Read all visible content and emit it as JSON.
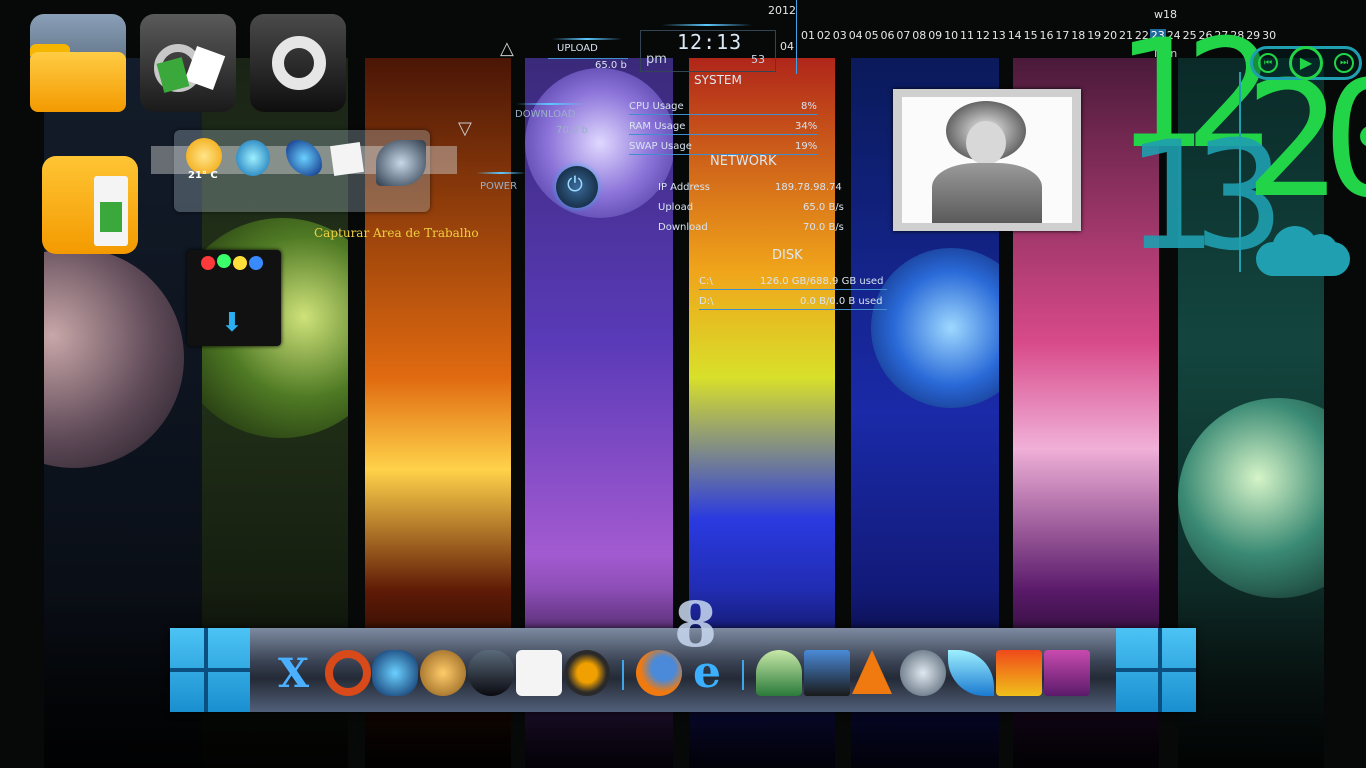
{
  "desktop": {
    "shortcut_label": "Capturar Area de Trabalho"
  },
  "weather": {
    "temperature": "21° C"
  },
  "network_meter": {
    "upload_label": "UPLOAD",
    "upload_value": "65.0 b",
    "download_label": "DOWNLOAD",
    "download_value": "70.0 b",
    "power_label": "POWER"
  },
  "digital_clock": {
    "time": "12:13",
    "ampm": "pm",
    "seconds": "53",
    "month": "04"
  },
  "calendar": {
    "year": "2012",
    "week": "w18",
    "days": [
      "01",
      "02",
      "03",
      "04",
      "05",
      "06",
      "07",
      "08",
      "09",
      "10",
      "11",
      "12",
      "13",
      "14",
      "15",
      "16",
      "17",
      "18",
      "19",
      "20",
      "21",
      "22",
      "23",
      "24",
      "25",
      "26",
      "27",
      "28",
      "29",
      "30"
    ],
    "today": "23",
    "today_weekday": "Mon"
  },
  "system_monitor": {
    "system_title": "SYSTEM",
    "cpu_label": "CPU Usage",
    "cpu_value": "8%",
    "ram_label": "RAM Usage",
    "ram_value": "34%",
    "swap_label": "SWAP Usage",
    "swap_value": "19%",
    "network_title": "NETWORK",
    "ip_label": "IP Address",
    "ip_value": "189.78.98.74",
    "upload_label": "Upload",
    "upload_value": "65.0 B/s",
    "download_label": "Download",
    "download_value": "70.0 B/s",
    "disk_title": "DISK",
    "c_label": "C:\\",
    "c_value": "126.0 GB/688.9 GB used",
    "d_label": "D:\\",
    "d_value": "0.0 B/0.0 B used"
  },
  "big_clock": {
    "hour_a": "12",
    "hour_b": "13",
    "minute": "20"
  },
  "dock": {
    "center_label": "8"
  },
  "colors": {
    "accent_blue": "#3ea6e8",
    "clock_green": "#22d447",
    "clock_teal": "#1f9fb0",
    "folder_yellow": "#f8b300"
  }
}
